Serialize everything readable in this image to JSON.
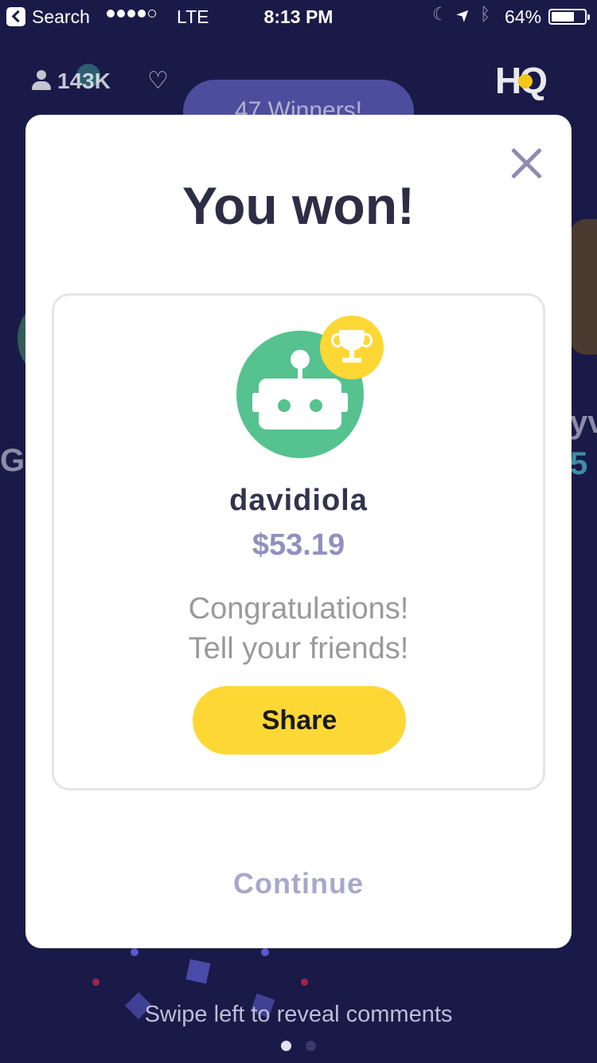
{
  "status_bar": {
    "back_label": "Search",
    "network": "LTE",
    "time": "8:13 PM",
    "battery_percent": "64%",
    "signal_bars_filled": 4,
    "signal_bars_total": 5,
    "battery_level": 0.64
  },
  "background": {
    "viewer_count": "143K",
    "winners_pill": "47 Winners!",
    "logo_text": "HQ",
    "left_name_fragment": "G",
    "right_name_fragment": "yv",
    "right_prize_fragment": "5",
    "swipe_hint": "Swipe left to reveal comments",
    "page_indicator": {
      "count": 2,
      "active": 1
    }
  },
  "modal": {
    "title": "You won!",
    "winner": {
      "username": "davidiola",
      "prize": "$53.19",
      "avatar_icon": "robot-avatar-icon",
      "badge_icon": "trophy-icon"
    },
    "message_line1": "Congratulations!",
    "message_line2": "Tell your friends!",
    "share_label": "Share",
    "continue_label": "Continue"
  },
  "colors": {
    "background": "#1a1a48",
    "card": "#ffffff",
    "title_text": "#2d2d45",
    "prize_text": "#9090c0",
    "share_button": "#fdd835",
    "avatar_green": "#55c28f",
    "continue_text": "#a8a8c8"
  }
}
